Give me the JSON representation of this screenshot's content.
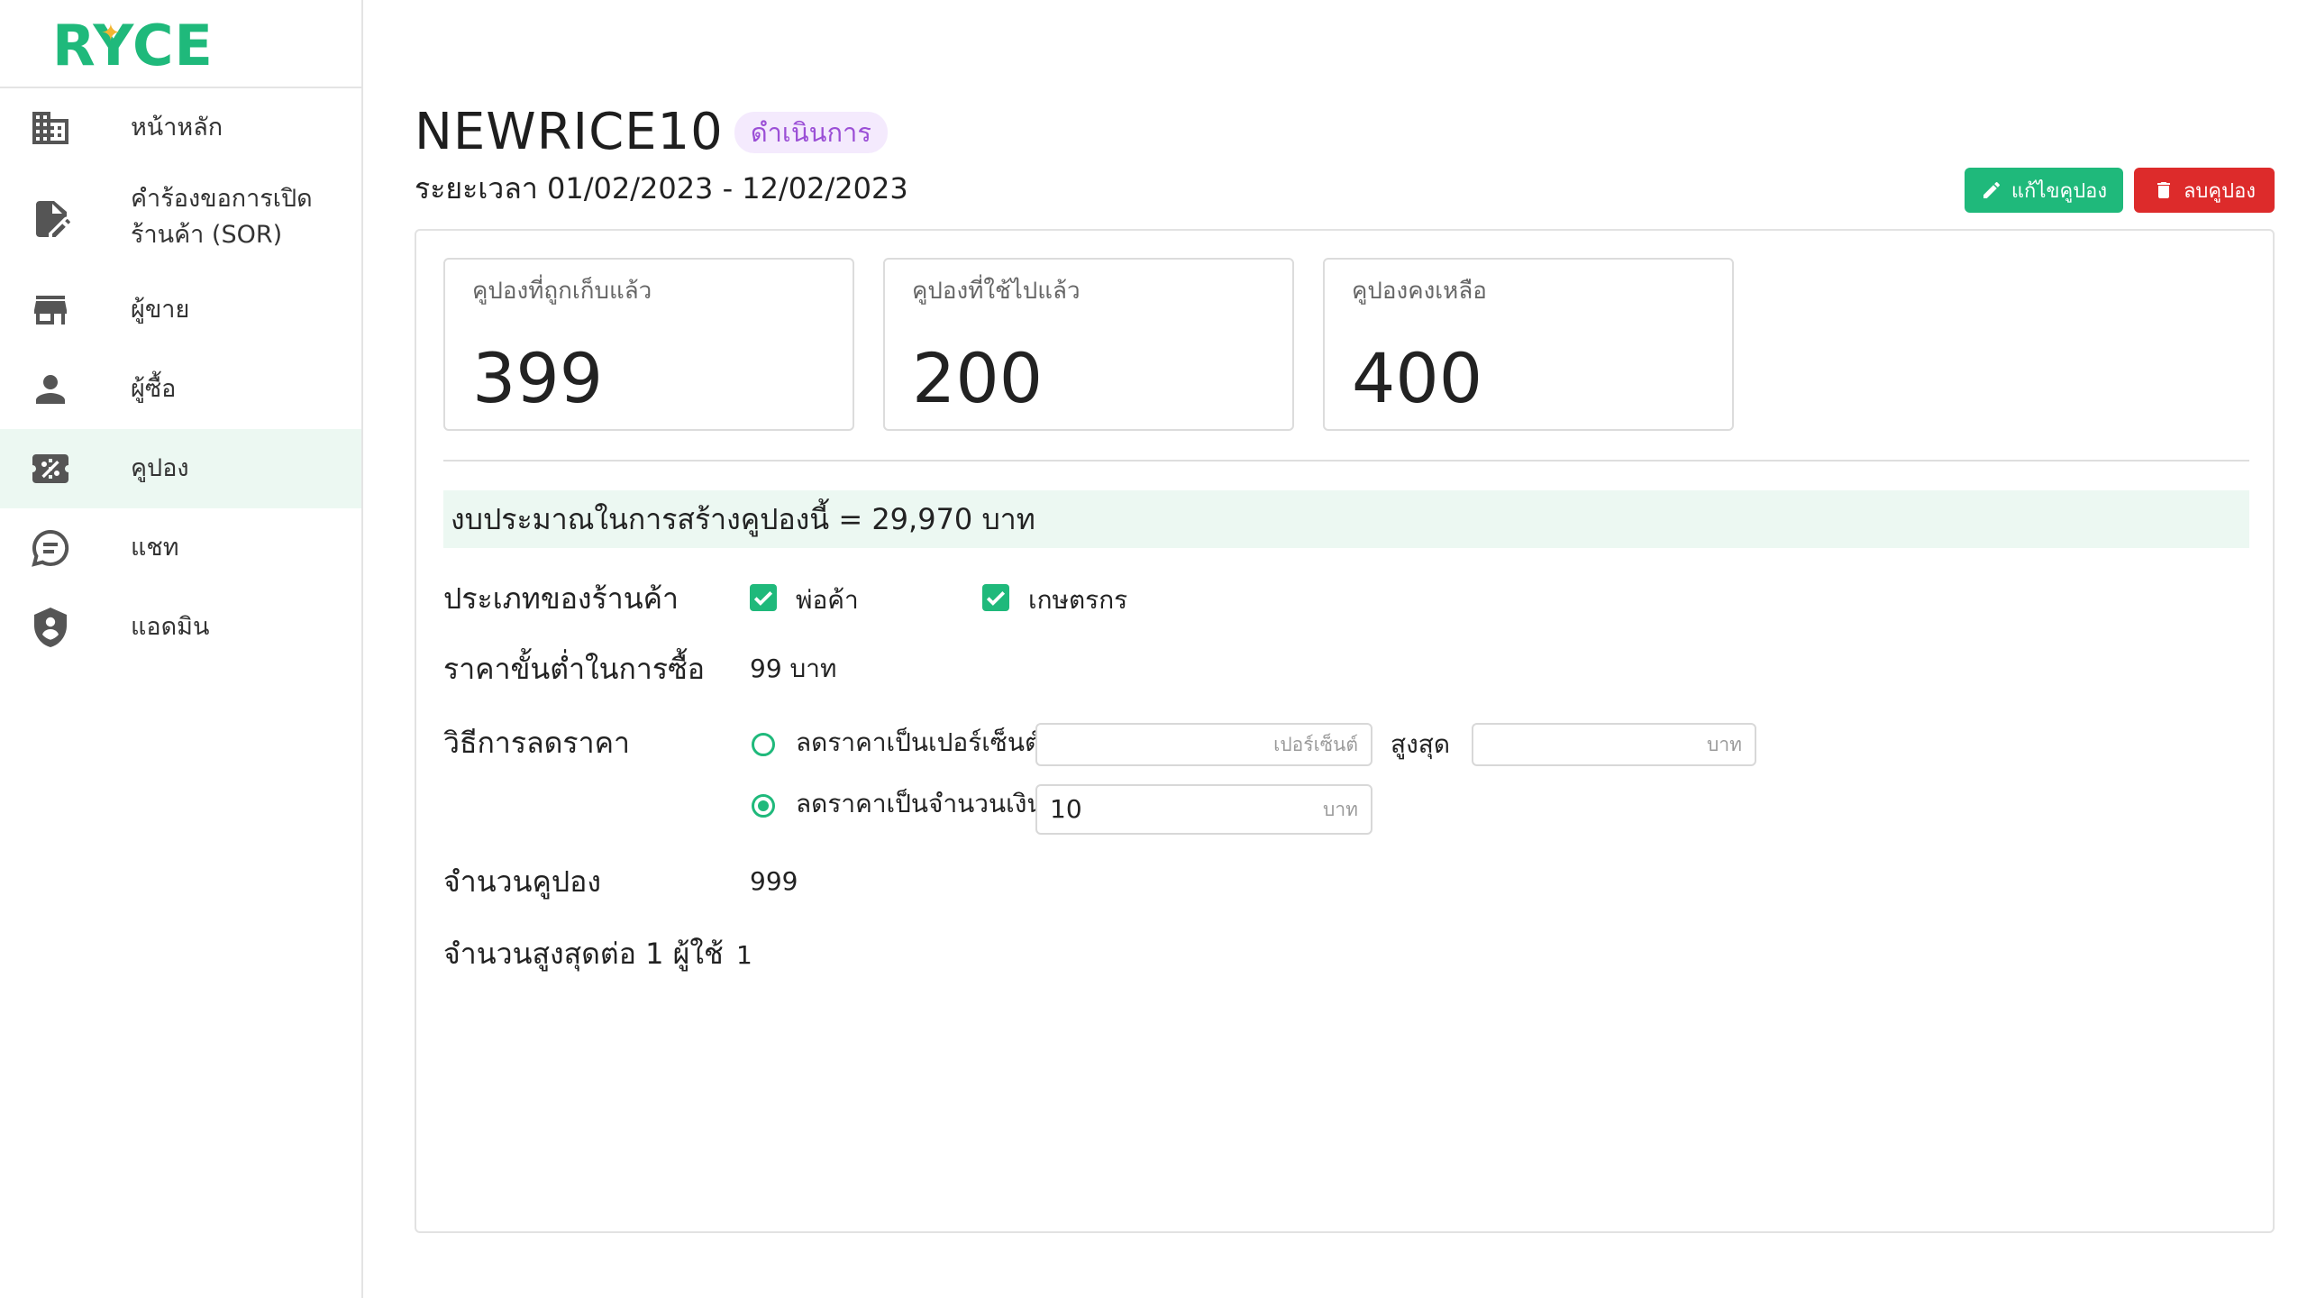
{
  "brand": {
    "logo": "RYCE",
    "accent": "#1fb97b"
  },
  "sidebar": {
    "items": [
      {
        "label": "หน้าหลัก",
        "icon": "building-icon"
      },
      {
        "label": "คำร้องขอการเปิด",
        "label2": "ร้านค้า (SOR)",
        "icon": "document-edit-icon"
      },
      {
        "label": "ผู้ขาย",
        "icon": "store-icon"
      },
      {
        "label": "ผู้ซื้อ",
        "icon": "person-icon"
      },
      {
        "label": "คูปอง",
        "icon": "coupon-percent-icon",
        "active": true
      },
      {
        "label": "แชท",
        "icon": "chat-icon"
      },
      {
        "label": "แอดมิน",
        "icon": "shield-person-icon"
      }
    ]
  },
  "header": {
    "code": "NEWRICE10",
    "status": "ดำเนินการ",
    "period": "ระยะเวลา 01/02/2023 - 12/02/2023",
    "edit_label": "แก้ไขคูปอง",
    "delete_label": "ลบคูปอง"
  },
  "stats": [
    {
      "label": "คูปองที่ถูกเก็บแล้ว",
      "value": "399"
    },
    {
      "label": "คูปองที่ใช้ไปแล้ว",
      "value": "200"
    },
    {
      "label": "คูปองคงเหลือ",
      "value": "400"
    }
  ],
  "budget": "งบประมาณในการสร้างคูปองนี้ = 29,970 บาท",
  "details": {
    "store_type_label": "ประเภทของร้านค้า",
    "store_types": [
      {
        "label": "พ่อค้า",
        "checked": true
      },
      {
        "label": "เกษตรกร",
        "checked": true
      }
    ],
    "min_price_label": "ราคาขั้นต่ำในการซื้อ",
    "min_price": "99 บาท",
    "discount_label": "วิธีการลดราคา",
    "percent_option": "ลดราคาเป็นเปอร์เซ็นต์",
    "percent_placeholder": "เปอร์เซ็นต์",
    "max_label": "สูงสุด",
    "max_placeholder": "บาท",
    "amount_option": "ลดราคาเป็นจำนวนเงิน",
    "amount_value": "10",
    "amount_unit": "บาท",
    "selected_option": "amount",
    "quantity_label": "จำนวนคูปอง",
    "quantity": "999",
    "per_user_label": "จำนวนสูงสุดต่อ 1 ผู้ใช้",
    "per_user": "1"
  }
}
